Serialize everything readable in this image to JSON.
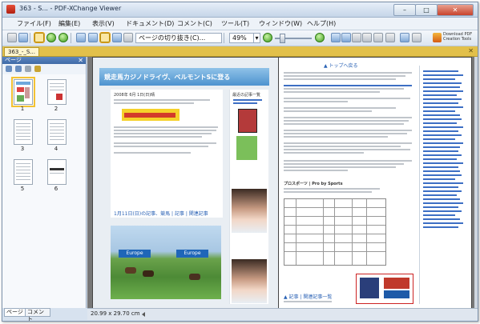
{
  "window": {
    "title": "363 - S... - PDF-XChange Viewer",
    "buttons": {
      "minimize": "–",
      "maximize": "□",
      "close": "✕"
    }
  },
  "menu": [
    "ファイル(F)",
    "編集(E)",
    "表示(V)",
    "ドキュメント(D)",
    "コメント(C)",
    "ツール(T)",
    "ウィンドウ(W)",
    "ヘルプ(H)"
  ],
  "toolbar": {
    "page_action": "ページの切り抜き(C)...",
    "zoom": "49%",
    "zoom_dropdown": "▾",
    "logo_line1": "Download PDF",
    "logo_line2": "Creation Tools"
  },
  "doc_tab": {
    "label": "363_-_S...",
    "close": "✕"
  },
  "left_panel": {
    "header": "ページ",
    "close": "✕",
    "thumbnails": [
      "1",
      "2",
      "3",
      "4",
      "5",
      "6"
    ],
    "tabs": [
      "ページ",
      "コメント"
    ]
  },
  "status": {
    "page_size": "20.99 x 29.70 cm"
  },
  "document": {
    "left_page": {
      "blog_title": "競走馬カジノドライヴ、ベルモントSに登る",
      "post_date": "2008年 6月 1日(日)晴",
      "side_title": "最近の記事一覧",
      "race_banner_1": "Europe",
      "race_banner_2": "Europe",
      "caption": "1月11日(日)の記事、競馬 | 記事 | 関連記事"
    },
    "right_page": {
      "head_link": "▲ トップへ戻る",
      "table_title": "プロスポーツ | Pro by Sports",
      "footer_link": "▲ 記事 | 関連記事一覧"
    }
  },
  "colors": {
    "accent": "#e2c04a",
    "panel_header": "#4a76b3",
    "blog_header": "#5fa0d6",
    "viewer_bg": "#787878"
  }
}
